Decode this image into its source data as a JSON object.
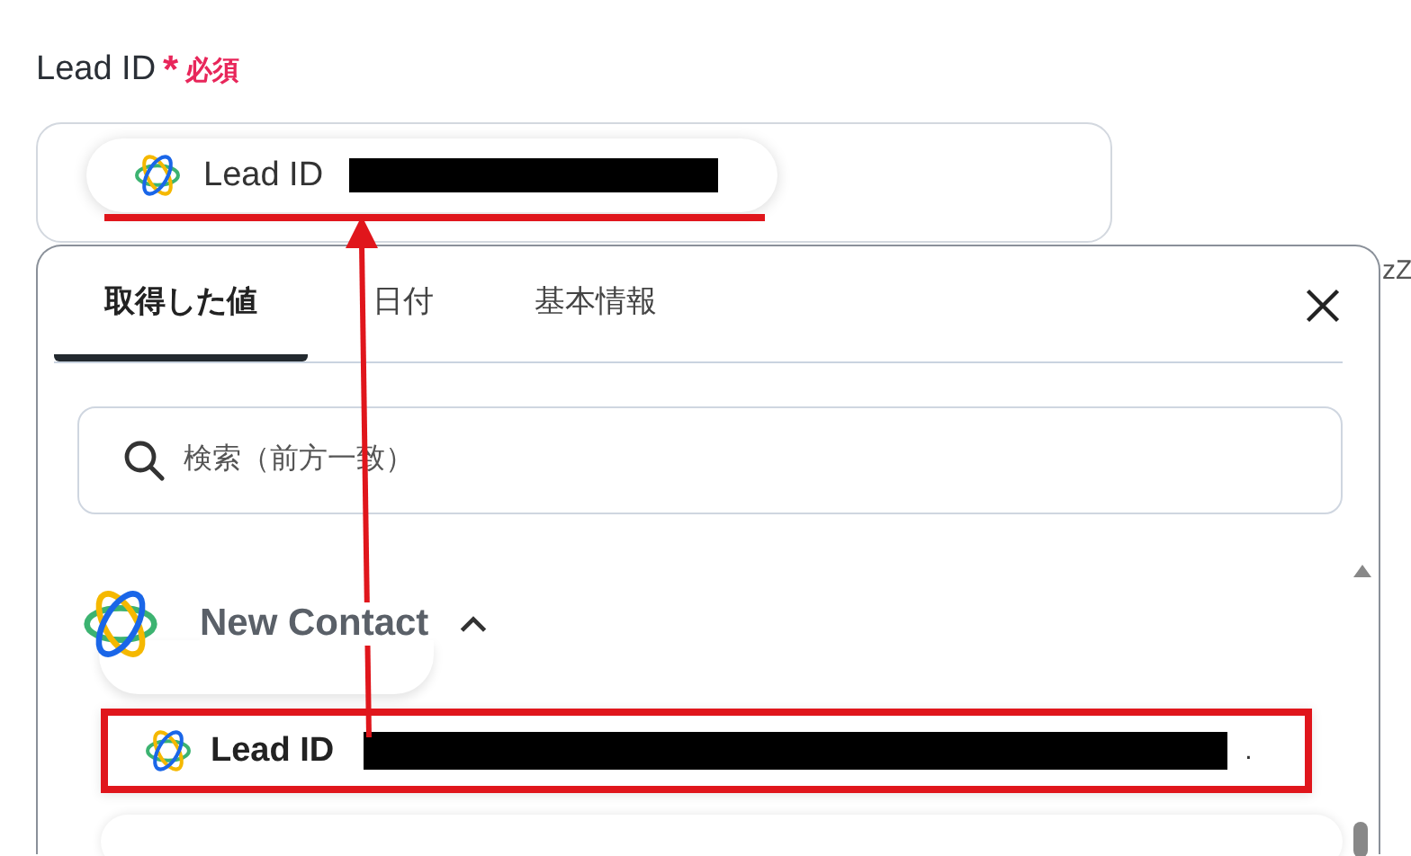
{
  "field": {
    "label": "Lead ID",
    "required_mark": "*",
    "required_text": "必須",
    "chip": {
      "label": "Lead ID"
    }
  },
  "side_text": "zZ",
  "popup": {
    "tabs": [
      {
        "label": "取得した値",
        "selected": true
      },
      {
        "label": "日付",
        "selected": false
      },
      {
        "label": "基本情報",
        "selected": false
      }
    ],
    "search": {
      "placeholder": "検索（前方一致）"
    },
    "groups": [
      {
        "name": "New Contact",
        "expanded": true,
        "items": [
          {
            "label": "Lead ID",
            "suffix": ".",
            "selected": true
          }
        ]
      }
    ]
  }
}
